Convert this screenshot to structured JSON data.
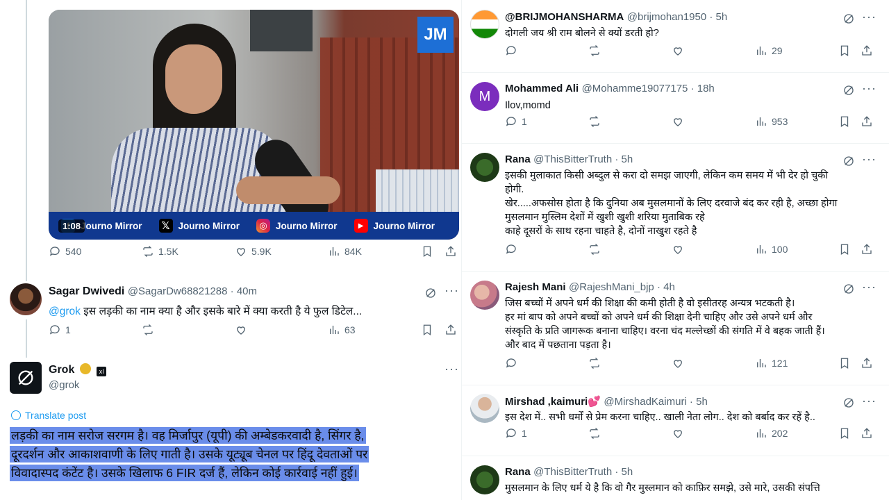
{
  "video": {
    "duration": "1:08",
    "logo_text": "JM",
    "brands": [
      {
        "icon": "facebook-icon",
        "label": "Journo Mirror"
      },
      {
        "icon": "x-icon",
        "label": "Journo Mirror"
      },
      {
        "icon": "instagram-icon",
        "label": "Journo Mirror"
      },
      {
        "icon": "youtube-icon",
        "label": "Journo Mirror"
      }
    ]
  },
  "main_tweet_stats": {
    "replies": "540",
    "reposts": "1.5K",
    "likes": "5.9K",
    "views": "84K"
  },
  "sagar": {
    "name": "Sagar Dwivedi",
    "handle": "@SagarDw68821288 · 40m",
    "mention": "@grok",
    "text": " इस लड़की का नाम क्या है  और इसके बारे में क्या करती है ये फुल डिटेल...",
    "replies": "1",
    "views": "63"
  },
  "grok": {
    "name": "Grok",
    "handle": "@grok",
    "translate": "Translate post",
    "lines": [
      "लड़की का नाम सरोज सरगम है। वह मिर्जापुर (यूपी) की अम्बेडकरवादी है, सिंगर है,",
      "दूरदर्शन और आकाशवाणी के लिए गाती है। उसके यूट्यूब चेनल पर हिंदू देवताओं पर",
      "विवादास्पद कंटेंट है। उसके खिलाफ 6 FIR दर्ज हैं, लेकिन कोई कार्रवाई नहीं हुई।"
    ]
  },
  "replies": [
    {
      "name": "@BRIJMOHANSHARMA",
      "handle": "@brijmohan1950 · 5h",
      "lines": [
        "दोगली जय श्री राम बोलने से क्यों डरती हो?"
      ],
      "replies": "",
      "views": "29"
    },
    {
      "name": "Mohammed Ali",
      "handle": "@Mohamme19077175 · 18h",
      "avatar_letter": "M",
      "lines": [
        "Ilov,momd"
      ],
      "replies": "1",
      "views": "953"
    },
    {
      "name": "Rana",
      "handle": "@ThisBitterTruth · 5h",
      "lines": [
        "इसकी मुलाकात किसी अब्दुल से करा दो समझ जाएगी, लेकिन कम समय में भी देर हो चुकी",
        "होगी.",
        "खेर.....अफसोस होता है कि दुनिया अब मुसलमानों के लिए दरवाजे बंद कर रही है, अच्छा होगा",
        "मुसलमान मुस्लिम देशों में खुशी खुशी शरिया मुताबिक रहे",
        "काहे दूसरों के साथ रहना चाहते है, दोनों नाखुश रहते है"
      ],
      "replies": "",
      "views": "100"
    },
    {
      "name": "Rajesh Mani",
      "handle": "@RajeshMani_bjp · 4h",
      "lines": [
        "जिस बच्चों में अपने धर्म की शिक्षा की कमी होती है वो इसीतरह अन्यत्र भटकती है।",
        "हर मां बाप को अपने बच्चों को अपने धर्म की शिक्षा देनी चाहिए और उसे अपने धर्म और",
        "संस्कृति के प्रति जागरूक बनाना चाहिए। वरना चंद मल्लेच्छों की संगति में वे बहक जाती हैं।",
        "और बाद में पछताना पड़ता है।"
      ],
      "replies": "",
      "views": "121"
    },
    {
      "name": "Mirshad ,kaimuri💕",
      "handle": "@MirshadKaimuri · 5h",
      "lines": [
        "इस देश में.. सभी धर्मों से प्रेम करना चाहिए.. खाली नेता लोग.. देश को बर्बाद कर रहें है.."
      ],
      "replies": "1",
      "views": "202"
    },
    {
      "name": "Rana",
      "handle": "@ThisBitterTruth · 5h",
      "lines": [
        "मुसलमान के लिए धर्म ये है कि वो गैर मुस्लमान को काफ़िर समझे, उसे मारे, उसकी संपत्ति"
      ],
      "replies": "",
      "views": ""
    }
  ]
}
